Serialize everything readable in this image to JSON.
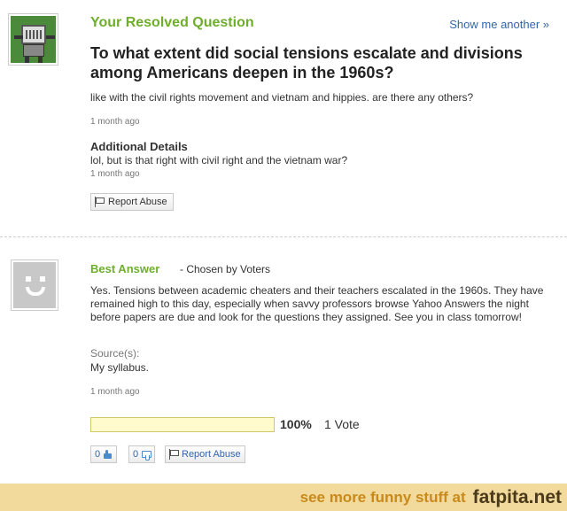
{
  "question": {
    "section_title": "Your Resolved Question",
    "show_another": "Show me another »",
    "title": "To what extent did social tensions escalate and divisions among Americans deepen in the 1960s?",
    "body": "like with the civil rights movement and vietnam and hippies. are there any others?",
    "time": "1 month ago",
    "additional_label": "Additional Details",
    "additional_text": "lol, but is that right with civil right and the vietnam war?",
    "additional_time": "1 month ago",
    "report_label": "Report Abuse"
  },
  "answer": {
    "label": "Best Answer",
    "chosen": "- Chosen by Voters",
    "text": "Yes. Tensions between academic cheaters and their teachers escalated in the 1960s. They have remained high to this day, especially when savvy professors browse Yahoo Answers the night before papers are due and look for the questions they assigned. See you in class tomorrow!",
    "sources_label": "Source(s):",
    "sources_text": "My syllabus.",
    "time": "1 month ago",
    "vote_fraction": 1.0,
    "vote_pct": "100%",
    "vote_count": "1 Vote",
    "thumbs_up": "0",
    "thumbs_down": "0",
    "report_label": "Report Abuse"
  },
  "footer": {
    "text": "see more funny stuff at",
    "site": "fatpita.net"
  },
  "colors": {
    "accent_green": "#6fae2c",
    "link_blue": "#3366aa",
    "footer_bg": "#f2d99c"
  }
}
